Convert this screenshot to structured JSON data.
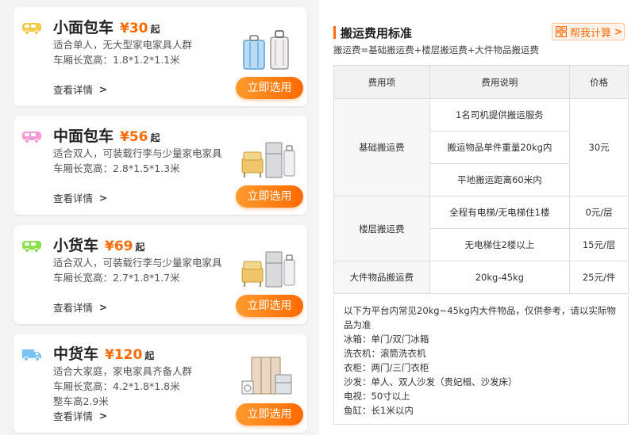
{
  "vehicles": [
    {
      "name": "小面包车",
      "price": "¥30",
      "suffix": "起",
      "desc": [
        "适合单人，无大型家电家具人群",
        "车厢长宽高：1.8*1.2*1.1米"
      ],
      "details": "查看详情",
      "select": "立即选用",
      "icon_color": "#f7c948"
    },
    {
      "name": "中面包车",
      "price": "¥56",
      "suffix": "起",
      "desc": [
        "适合双人，可装载行李与少量家电家具",
        "车厢长宽高：2.8*1.5*1.3米"
      ],
      "details": "查看详情",
      "select": "立即选用",
      "icon_color": "#f59ad6"
    },
    {
      "name": "小货车",
      "price": "¥69",
      "suffix": "起",
      "desc": [
        "适合双人，可装载行李与少量家电家具",
        "车厢长宽高：2.7*1.8*1.7米"
      ],
      "details": "查看详情",
      "select": "立即选用",
      "icon_color": "#8be04c"
    },
    {
      "name": "中货车",
      "price": "¥120",
      "suffix": "起",
      "desc": [
        "适合大家庭，家电家具齐备人群",
        "车厢长宽高：4.2*1.8*1.8米",
        "整车高2.9米"
      ],
      "details": "查看详情",
      "select": "立即选用",
      "icon_color": "#7cc3f2"
    }
  ],
  "fee": {
    "title": "搬运费用标准",
    "calc_label": "帮我计算",
    "formula": "搬运费=基础搬运费+楼层搬运费+大件物品搬运费",
    "headers": [
      "费用项",
      "费用说明",
      "价格"
    ],
    "basic": {
      "label": "基础搬运费",
      "items": [
        "1名司机提供搬运服务",
        "搬运物品单件重量20kg内",
        "平地搬运距离60米内"
      ],
      "price": "30元"
    },
    "floor": {
      "label": "楼层搬运费",
      "rows": [
        {
          "desc": "全程有电梯/无电梯住1楼",
          "price": "0元/层"
        },
        {
          "desc": "无电梯住2楼以上",
          "price": "15元/层"
        }
      ]
    },
    "large": {
      "label": "大件物品搬运费",
      "desc": "20kg-45kg",
      "price": "25元/件"
    },
    "notes": [
      "以下为平台内常见20kg~45kg内大件物品，仅供参考，请以实际物品为准",
      "冰箱：单门/双门冰箱",
      "洗衣机：滚筒洗衣机",
      "衣柜：两门/三门衣柜",
      "沙发：单人、双人沙发（贵妃榻、沙发床）",
      "电视：50寸以上",
      "鱼缸：长1米以内"
    ],
    "accent": "#ff6a00"
  }
}
